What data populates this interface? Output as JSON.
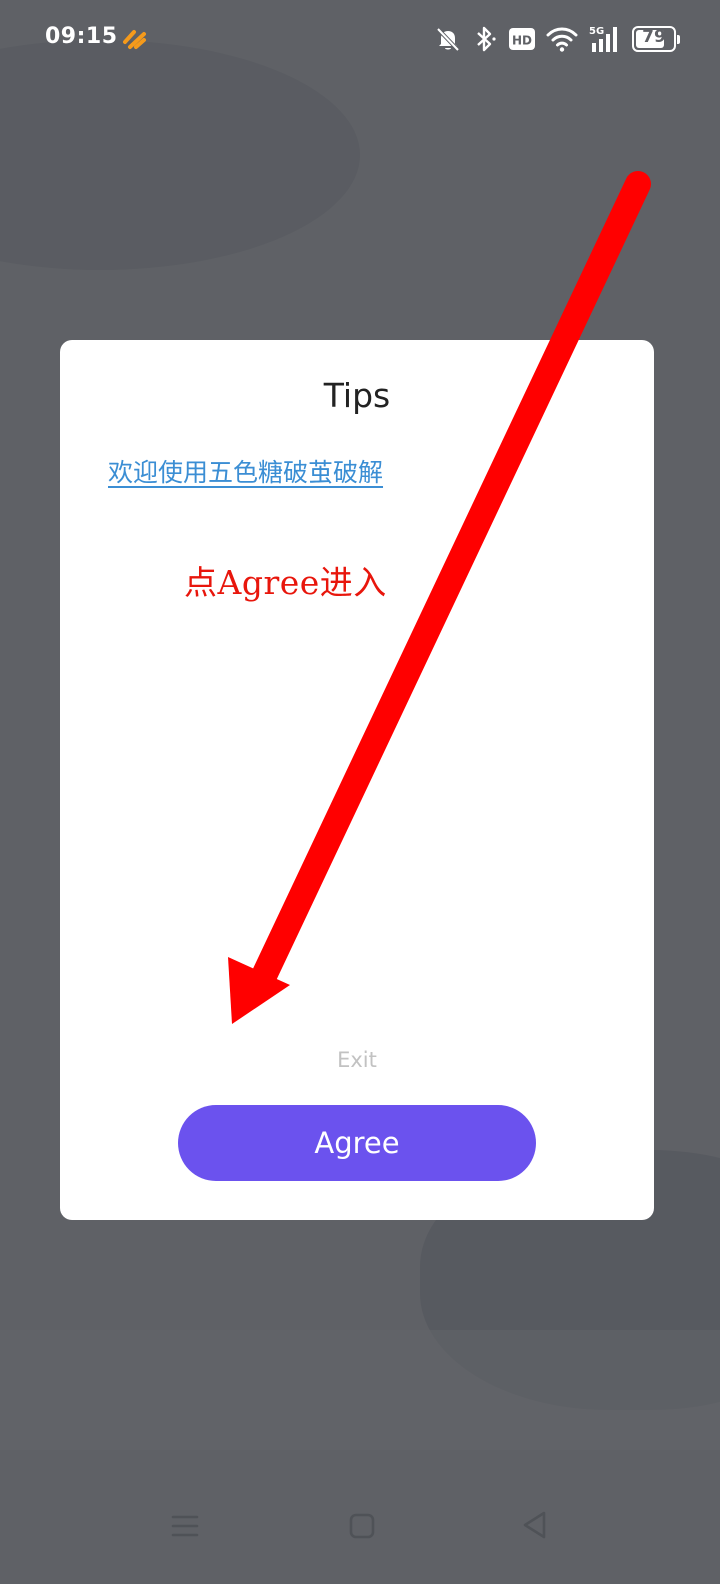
{
  "status_bar": {
    "time": "09:15",
    "battery": "79",
    "battery_level": 0.79,
    "icons": [
      "app-badge-icon",
      "bell-off-icon",
      "bluetooth-icon",
      "hd-icon",
      "wifi-icon",
      "cellular-5g-icon",
      "battery-icon"
    ]
  },
  "dialog": {
    "title": "Tips",
    "welcome_link": "欢迎使用五色糖破茧破解",
    "annotation": "点Agree进入",
    "exit_label": "Exit",
    "agree_label": "Agree"
  },
  "nav_bar": {
    "icons": [
      "menu-icon",
      "home-icon",
      "back-icon"
    ]
  },
  "colors": {
    "background": "#5f6166",
    "dialog": "#ffffff",
    "accent": "#6b52ee",
    "link": "#3b8ed4",
    "annotation": "#e8160c",
    "arrow": "#ff0000",
    "badge": "#f59a1b"
  }
}
